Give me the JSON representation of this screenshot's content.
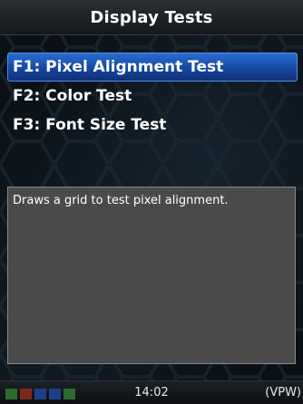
{
  "header": {
    "title": "Display Tests"
  },
  "menu": {
    "items": [
      {
        "label": "F1: Pixel Alignment Test",
        "selected": true
      },
      {
        "label": "F2: Color Test",
        "selected": false
      },
      {
        "label": "F3: Font Size Test",
        "selected": false
      }
    ]
  },
  "description": {
    "text": "Draws a grid to test pixel alignment."
  },
  "status_bar": {
    "time": "14:02",
    "mode": "(VPW)",
    "signal_colors": [
      "#2e6b2e",
      "#7a2a1a",
      "#1e3f8a",
      "#1e3f8a",
      "#2e6b2e"
    ]
  },
  "colors": {
    "selection": "#1f5bc0",
    "panel": "#4a4a4a",
    "background": "#0a1016"
  }
}
